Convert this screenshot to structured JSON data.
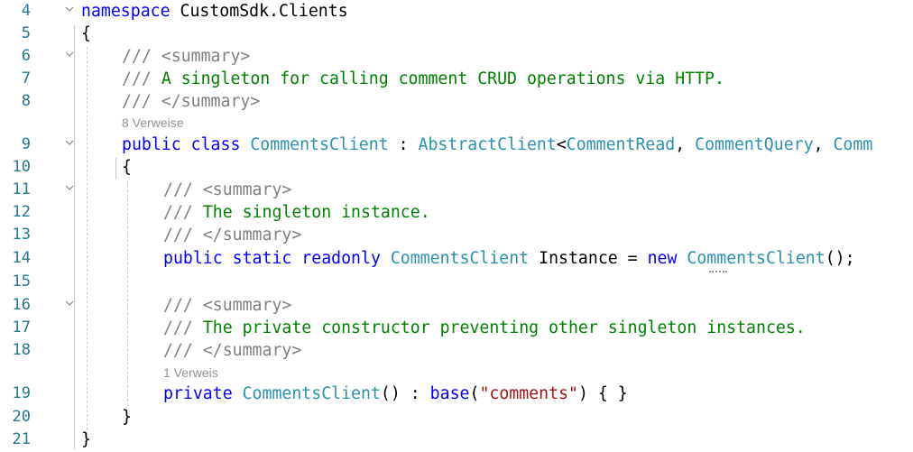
{
  "editor": {
    "line_numbers": [
      "4",
      "5",
      "6",
      "7",
      "8",
      "9",
      "10",
      "11",
      "12",
      "13",
      "14",
      "15",
      "16",
      "17",
      "18",
      "19",
      "20",
      "21"
    ],
    "lines": {
      "l4_kw": "namespace",
      "l4_rest": " CustomSdk.Clients",
      "l5": "{",
      "l6_doc": "/// <summary>",
      "l7_doc": "/// ",
      "l7_text": "A singleton for calling comment CRUD operations via HTTP.",
      "l8_doc": "/// </summary>",
      "lens1": "8 Verweise",
      "l9_kw": "public class ",
      "l9_type": "CommentsClient",
      "l9_colon": " : ",
      "l9_base": "AbstractClient",
      "l9_lt": "<",
      "l9_g1": "CommentRead",
      "l9_comma1": ", ",
      "l9_g2": "CommentQuery",
      "l9_comma2": ", ",
      "l9_g3": "Comm",
      "l10": "{",
      "l11_doc": "/// <summary>",
      "l12_doc": "/// ",
      "l12_text": "The singleton instance.",
      "l13_doc": "/// </summary>",
      "l14_kw": "public static readonly ",
      "l14_type": "CommentsClient",
      "l14_mid": " Instance = ",
      "l14_new": "new ",
      "l14_ctor": "CommentsClient",
      "l14_end": "();",
      "l16_doc": "/// <summary>",
      "l17_doc": "/// ",
      "l17_text": "The private constructor preventing other singleton instances.",
      "l18_doc": "/// </summary>",
      "lens2": "1 Verweis",
      "l19_kw": "private ",
      "l19_type": "CommentsClient",
      "l19_mid": "() : ",
      "l19_base": "base",
      "l19_p1": "(",
      "l19_str": "\"comments\"",
      "l19_end": ") { }",
      "l20": "}",
      "l21": "}"
    }
  }
}
